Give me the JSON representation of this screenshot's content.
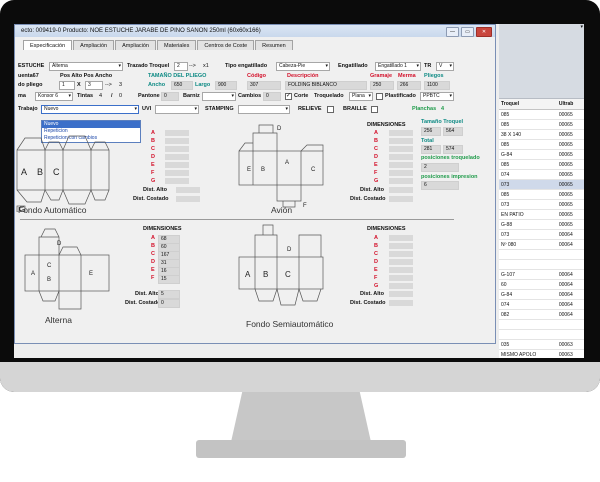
{
  "window": {
    "title": "ecto: 009419-0   Producto: NOE   ESTUCHE JARABE DE PINO SANON 250ml (60x60x166)",
    "buttons": [
      "—",
      "▭",
      "✕"
    ]
  },
  "tabs": [
    "Especificación",
    "Ampliación",
    "Ampliación",
    "Materiales",
    "Centros de Coste",
    "Resumen"
  ],
  "row1": {
    "estuche_label": "ESTUCHE",
    "estuche_value": "Alterna",
    "trazado_label": "Trazado Troquel",
    "trazado_value": "2",
    "trazado_arrow": "-->",
    "trazado_x": "x1",
    "tipo_label": "Tipo engatillado",
    "tipo_value": "Cabeza-Pie",
    "engat_label": "Engatillado",
    "engat_value": "Engatillado 1",
    "tr_label": "TR",
    "tr_value": "V"
  },
  "row2": {
    "cuenta": "uenta67",
    "pos_label": "Pos Alto Pos Ancho",
    "tamano_title": "TAMAÑO DEL PLIEGO",
    "codigo_label": "Código",
    "descripcion_label": "Descripción",
    "gramaje_label": "Gramaje",
    "merma_label": "Merma",
    "pliegos_label": "Pliegos"
  },
  "row3": {
    "pliego_label": "do pliego",
    "pliego_value": "1",
    "x_label": "X",
    "x_value": "3",
    "arrow": "-->",
    "arrow_value": "3",
    "ancho_label": "Ancho",
    "ancho_value": "650",
    "largo_label": "Largo",
    "largo_value": "900",
    "codigo_value": "307",
    "descripcion_value": "FOLDING BIBLANCO",
    "gramaje_value": "250",
    "merma_value": "266",
    "pliegos_value": "1100"
  },
  "row4": {
    "tinta_label": "ma",
    "tinta_value": "Konsor 6",
    "tintas_label": "Tintas",
    "tintas_value": "4",
    "slash": "/",
    "slash_value": "0",
    "pantone_label": "Pantone",
    "pantone_value": "0",
    "barniz_label": "Barniz",
    "cambios_label": "Cambios",
    "cambios_value": "0",
    "corte_label": "Corte",
    "troquelado_label": "Troquelado",
    "troquelado_value": "Plana",
    "plastificado_label": "Plastificado",
    "plastificado_value": "PPBTC"
  },
  "row5": {
    "trabajo_label": "Trabajo",
    "trabajo_value": "Nuevo",
    "uvi_label": "UVI",
    "stamping_label": "STAMPING",
    "relieve_label": "RELIEVE",
    "braille_label": "BRAILLE",
    "planchas_label": "Planchas",
    "planchas_value": "4"
  },
  "dropdown_options": [
    "Nuevo",
    "Repeticion",
    "Repeticion con cambios"
  ],
  "letters": [
    "A",
    "B",
    "C",
    "D",
    "E",
    "F",
    "G"
  ],
  "dimensiones": "DIMENSIONES",
  "dist_alto": "Dist. Alto",
  "dist_costado": "Dist. Costado",
  "alterna_values": {
    "A": "68",
    "B": "60",
    "C": "167",
    "D": "31",
    "E": "16",
    "F": "15",
    "dist_alto": "5",
    "dist_costado": "0"
  },
  "troquel_info": {
    "tamano_label": "Tamaño Troquel",
    "tamano_a": "256",
    "tamano_b": "564",
    "total_label": "Total",
    "total_a": "281",
    "total_b": "574",
    "posiciones_label": "posiciones troquelado",
    "posiciones_value": "2",
    "impresion_label": "posiciones impresion",
    "impresion_value": "6"
  },
  "captions": {
    "fondo_auto": "Fondo Automático",
    "avion": "Avión",
    "alterna": "Alterna",
    "semiauto": "Fondo Semiautomático"
  },
  "diagram_letters": {
    "A": "A",
    "B": "B",
    "C": "C",
    "D": "D",
    "E": "E",
    "F": "F",
    "G": "G"
  },
  "list": {
    "col1": "Troquel",
    "col2": "Ultrab",
    "rows": [
      [
        "085",
        "00065"
      ],
      [
        "085",
        "00065"
      ],
      [
        "38 X 140",
        "00065"
      ],
      [
        "085",
        "00065"
      ],
      [
        "G-84",
        "00065"
      ],
      [
        "085",
        "00065"
      ],
      [
        "074",
        "00065"
      ],
      [
        "073",
        "00065"
      ],
      [
        "085",
        "00065"
      ],
      [
        "073",
        "00065"
      ],
      [
        "EN PATIO",
        "00065"
      ],
      [
        "G-88",
        "00065"
      ],
      [
        "073",
        "00064"
      ],
      [
        "Nº 080",
        "00064"
      ],
      [
        "",
        ""
      ],
      [
        "",
        ""
      ],
      [
        "G-107",
        "00064"
      ],
      [
        "60",
        "00064"
      ],
      [
        "G-84",
        "00064"
      ],
      [
        "074",
        "00064"
      ],
      [
        "082",
        "00064"
      ],
      [
        "",
        ""
      ],
      [
        "",
        ""
      ],
      [
        "035",
        "00063"
      ],
      [
        "MISMO APOLO",
        "00063"
      ]
    ],
    "selected_index": 7
  }
}
